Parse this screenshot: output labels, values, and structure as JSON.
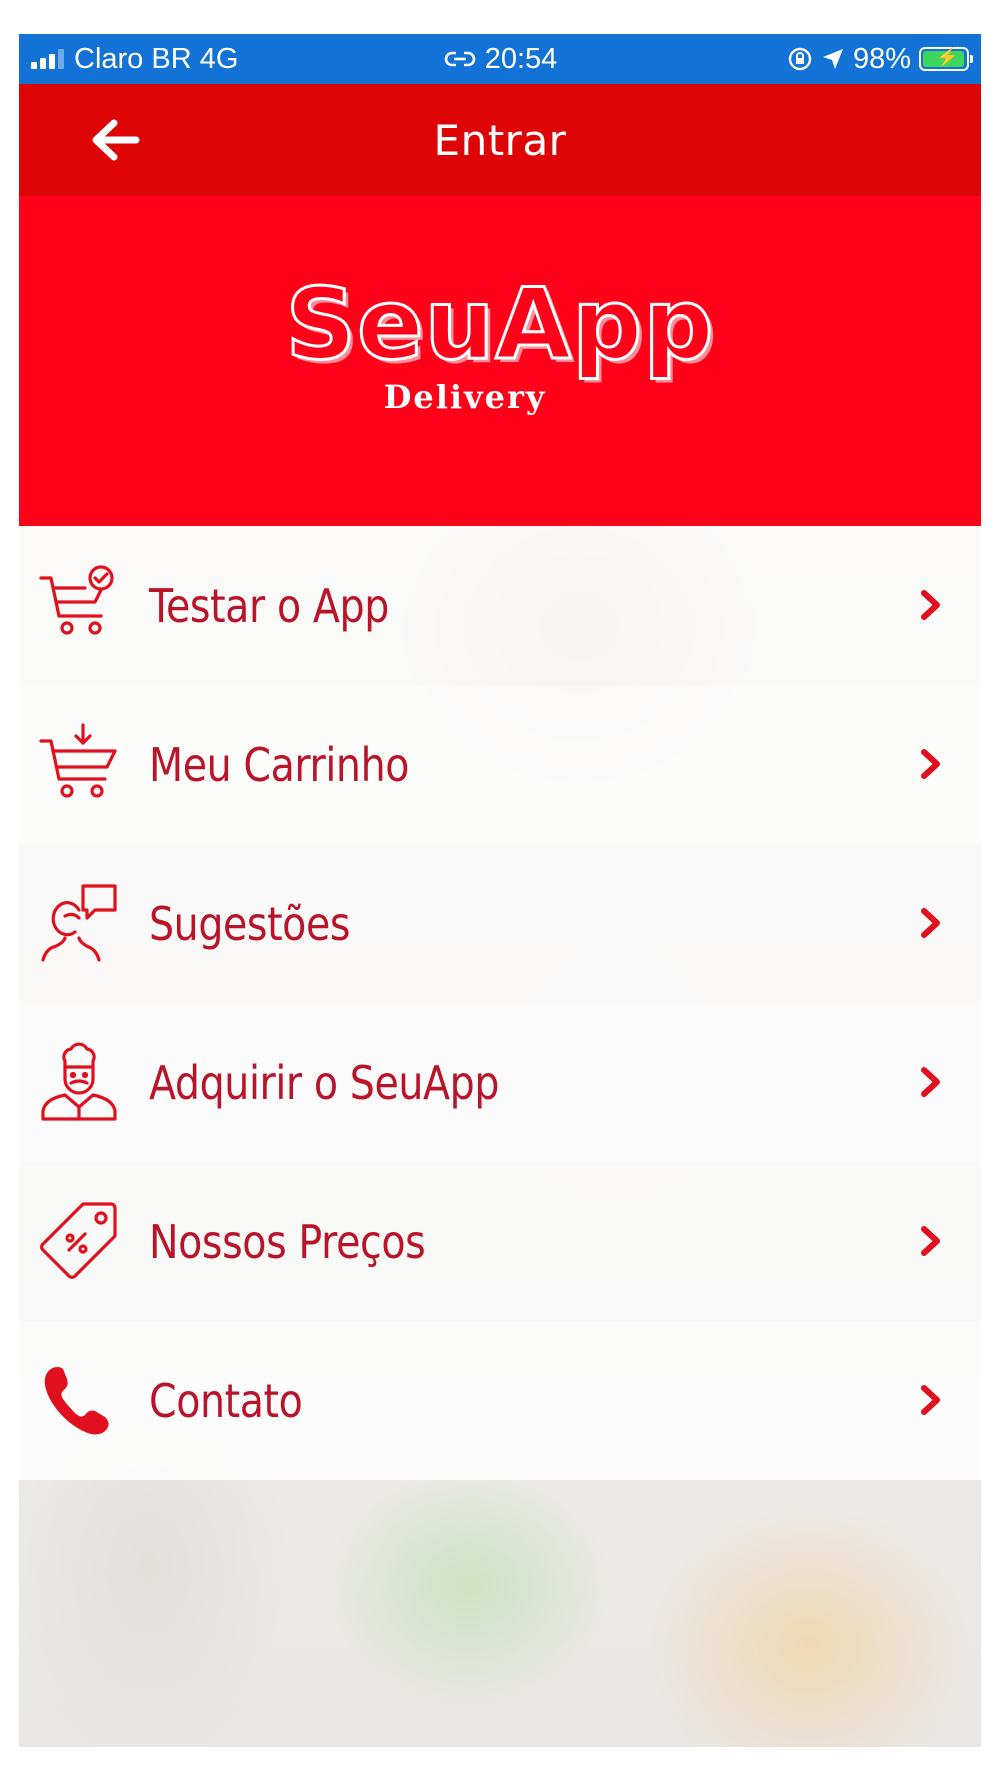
{
  "status_bar": {
    "carrier": "Claro BR 4G",
    "time": "20:54",
    "battery": "98%",
    "battery_level": 0.98,
    "icons": [
      "signal-icon",
      "link-icon",
      "rotation-lock-icon",
      "location-arrow-icon",
      "battery-icon"
    ]
  },
  "nav": {
    "title": "Entrar",
    "back_icon": "arrow-left-icon"
  },
  "banner": {
    "logo_main": "SeuApp",
    "logo_sub": "Delivery"
  },
  "menu": {
    "items": [
      {
        "label": "Testar o App",
        "icon": "cart-check-icon"
      },
      {
        "label": "Meu Carrinho",
        "icon": "cart-download-icon"
      },
      {
        "label": "Sugestões",
        "icon": "person-chat-icon"
      },
      {
        "label": "Adquirir o SeuApp",
        "icon": "chef-icon"
      },
      {
        "label": "Nossos Preços",
        "icon": "price-tag-icon"
      },
      {
        "label": "Contato",
        "icon": "phone-icon"
      }
    ],
    "chevron_icon": "chevron-right-icon"
  },
  "colors": {
    "status_bar": "#1272d6",
    "nav_bar": "#de0507",
    "banner": "#ff0219",
    "menu_text": "#b8152a",
    "icon": "#e0101e"
  }
}
